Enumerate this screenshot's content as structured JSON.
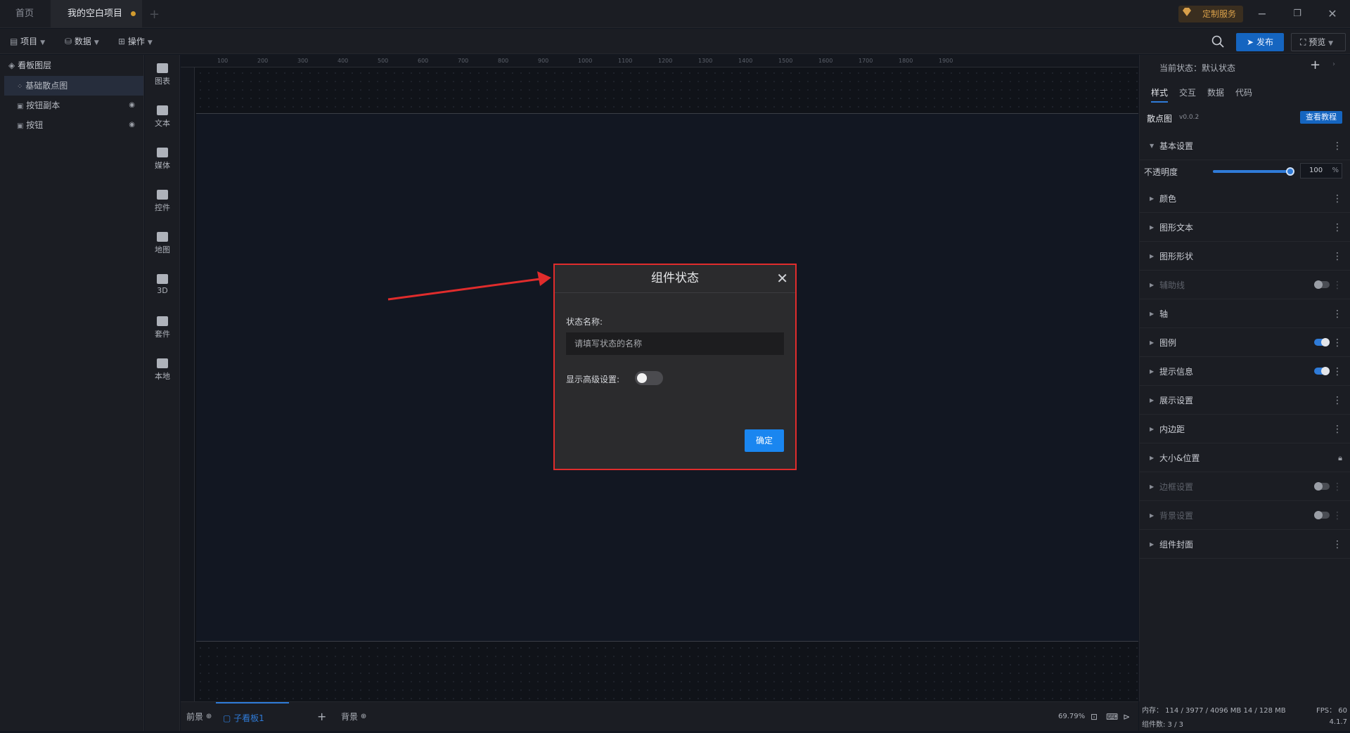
{
  "titlebar": {
    "tab_home": "首页",
    "tab_project": "我的空白项目",
    "custom_service": "定制服务"
  },
  "toolbar": {
    "menu_project": "项目",
    "menu_data": "数据",
    "menu_operate": "操作",
    "publish": "发布",
    "preview": "预览"
  },
  "layers": {
    "title": "看板图层",
    "items": [
      {
        "label": "基础散点图"
      },
      {
        "label": "按钮副本"
      },
      {
        "label": "按钮"
      }
    ]
  },
  "components": [
    "图表",
    "文本",
    "媒体",
    "控件",
    "地图",
    "3D",
    "套件",
    "本地"
  ],
  "ruler": {
    "h_labels": [
      "100",
      "200",
      "300",
      "400",
      "500",
      "600",
      "700",
      "800",
      "900",
      "1000",
      "1100",
      "1200",
      "1300",
      "1400",
      "1500",
      "1600",
      "1700",
      "1800",
      "1900"
    ]
  },
  "bottom": {
    "foreground": "前景",
    "sub_board": "子看板1",
    "background": "背景",
    "zoom": "69.79%"
  },
  "rightpanel": {
    "current_state": "当前状态：默认状态",
    "tabs": [
      "样式",
      "交互",
      "数据",
      "代码"
    ],
    "component_name": "散点图",
    "component_version": "v0.0.2",
    "tutorial": "查看教程",
    "basic_settings": "基本设置",
    "opacity_label": "不透明度",
    "opacity_value": "100",
    "opacity_unit": "%",
    "opacity_level": 1.0,
    "sections": [
      {
        "label": "颜色"
      },
      {
        "label": "图形文本"
      },
      {
        "label": "图形形状"
      },
      {
        "label": "辅助线"
      },
      {
        "label": "轴"
      },
      {
        "label": "图例"
      },
      {
        "label": "提示信息"
      },
      {
        "label": "展示设置"
      },
      {
        "label": "内边距"
      },
      {
        "label": "大小&位置"
      },
      {
        "label": "边框设置"
      },
      {
        "label": "背景设置"
      },
      {
        "label": "组件封面"
      }
    ]
  },
  "status": {
    "memory": "内存： 114 / 3977 / 4096 MB  14 / 128 MB",
    "fps": "FPS： 60",
    "component_count": "组件数: 3 / 3",
    "version": "4.1.7"
  },
  "dialog": {
    "title": "组件状态",
    "state_name_label": "状态名称:",
    "state_name_placeholder": "请填写状态的名称",
    "state_name_value": "",
    "advanced_label": "显示高级设置:",
    "advanced_enabled": false,
    "confirm": "确定"
  },
  "colors": {
    "highlight": "#e02c2c",
    "primary": "#1a86f0"
  }
}
